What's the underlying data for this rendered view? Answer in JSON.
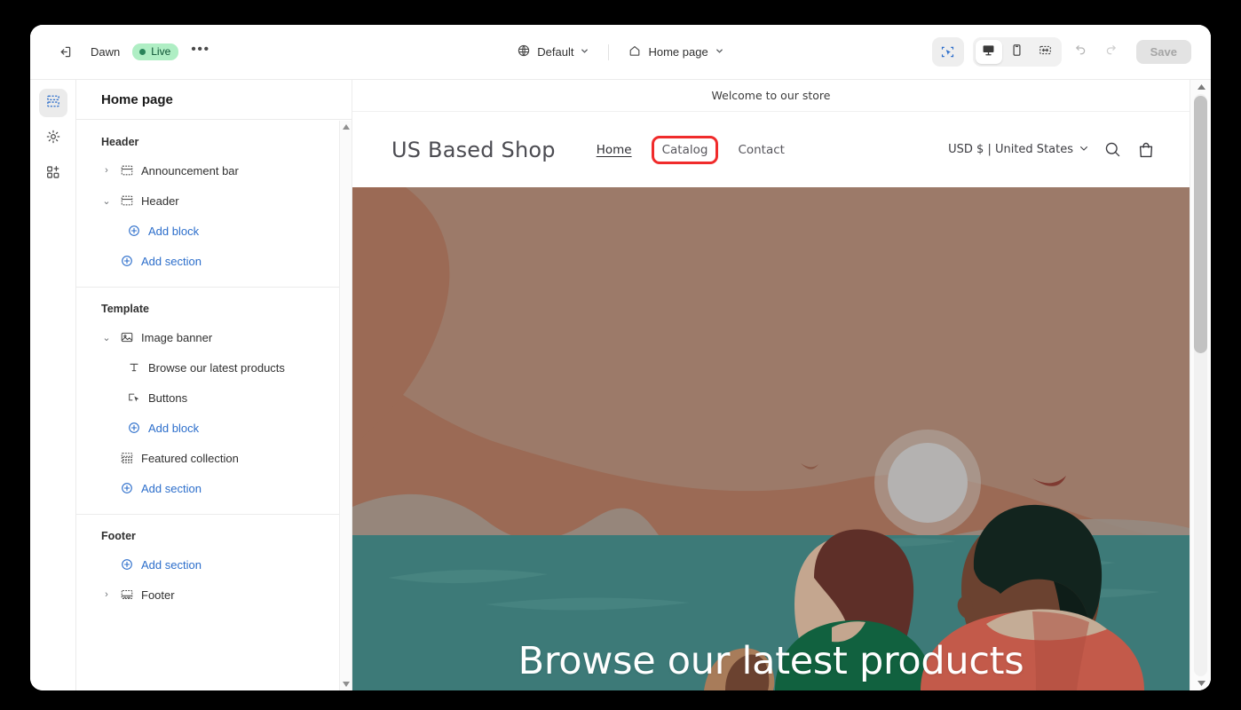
{
  "topbar": {
    "exit_icon": "exit-icon",
    "theme_name": "Dawn",
    "status_badge": "Live",
    "more_label": "•••",
    "locale_chip": {
      "icon": "globe-icon",
      "label": "Default",
      "caret": "chevron-down-icon"
    },
    "page_chip": {
      "icon": "home-icon",
      "label": "Home page",
      "caret": "chevron-down-icon"
    },
    "tools": [
      {
        "name": "inspector-tool",
        "icon": "select-inspect-icon",
        "active": true
      },
      {
        "name": "desktop-view",
        "icon": "desktop-icon",
        "active": true
      },
      {
        "name": "mobile-view",
        "icon": "mobile-icon",
        "active": false
      },
      {
        "name": "fullwidth-view",
        "icon": "resize-width-icon",
        "active": false
      }
    ],
    "undo_icon": "undo-icon",
    "redo_icon": "redo-icon",
    "save_label": "Save",
    "save_disabled": true
  },
  "rail": [
    {
      "name": "sections-rail-item",
      "icon": "sections-icon",
      "active": true
    },
    {
      "name": "settings-rail-item",
      "icon": "gear-icon",
      "active": false
    },
    {
      "name": "apps-rail-item",
      "icon": "apps-add-icon",
      "active": false
    }
  ],
  "sidebar": {
    "title": "Home page",
    "groups": [
      {
        "label": "Header",
        "rows": [
          {
            "twisty": "›",
            "icon": "section-icon",
            "label": "Announcement bar",
            "kind": "section",
            "indent": 0
          },
          {
            "twisty": "⌄",
            "icon": "section-icon",
            "label": "Header",
            "kind": "section",
            "indent": 0
          },
          {
            "twisty": "",
            "icon": "plus-circle-icon",
            "label": "Add block",
            "kind": "add",
            "indent": 2
          },
          {
            "twisty": "",
            "icon": "plus-circle-icon",
            "label": "Add section",
            "kind": "add",
            "indent": 1
          }
        ]
      },
      {
        "label": "Template",
        "rows": [
          {
            "twisty": "⌄",
            "icon": "image-banner-icon",
            "label": "Image banner",
            "kind": "section",
            "indent": 0
          },
          {
            "twisty": "",
            "icon": "text-block-icon",
            "label": "Browse our latest products",
            "kind": "block",
            "indent": 2
          },
          {
            "twisty": "",
            "icon": "button-block-icon",
            "label": "Buttons",
            "kind": "block",
            "indent": 2
          },
          {
            "twisty": "",
            "icon": "plus-circle-icon",
            "label": "Add block",
            "kind": "add",
            "indent": 2
          },
          {
            "twisty": "",
            "icon": "collection-icon",
            "label": "Featured collection",
            "kind": "section",
            "indent": 1
          },
          {
            "twisty": "",
            "icon": "plus-circle-icon",
            "label": "Add section",
            "kind": "add",
            "indent": 1
          }
        ]
      },
      {
        "label": "Footer",
        "rows": [
          {
            "twisty": "",
            "icon": "plus-circle-icon",
            "label": "Add section",
            "kind": "add",
            "indent": 1
          },
          {
            "twisty": "›",
            "icon": "footer-icon",
            "label": "Footer",
            "kind": "section",
            "indent": 0
          }
        ]
      }
    ],
    "scrollbar": {
      "up": "▲",
      "down": "▼"
    }
  },
  "preview": {
    "announcement": "Welcome to our store",
    "store_name": "US Based Shop",
    "nav": [
      {
        "label": "Home",
        "state": "underlined"
      },
      {
        "label": "Catalog",
        "state": "highlighted"
      },
      {
        "label": "Contact",
        "state": "normal"
      }
    ],
    "currency": "USD $ | United States",
    "currency_caret": "chevron-down-icon",
    "search_icon": "search-icon",
    "cart_icon": "shopping-bag-icon",
    "hero_title": "Browse our latest products",
    "scrollbar": {
      "up": "▲",
      "down": "▼"
    }
  },
  "colors": {
    "accent_blue": "#2c6ecb",
    "highlight_red": "#f02b2b",
    "live_green_bg": "#afeec4",
    "live_green_text": "#0c5132",
    "sky": "#9c7a69",
    "sky_dark": "#9b6a55",
    "mountain_grey": "#6e717c",
    "mountain_dark": "#565a62",
    "pine_green": "#14503b",
    "water_teal": "#3d7a78",
    "shirt_red": "#c35a4a",
    "top_green": "#11613f"
  }
}
